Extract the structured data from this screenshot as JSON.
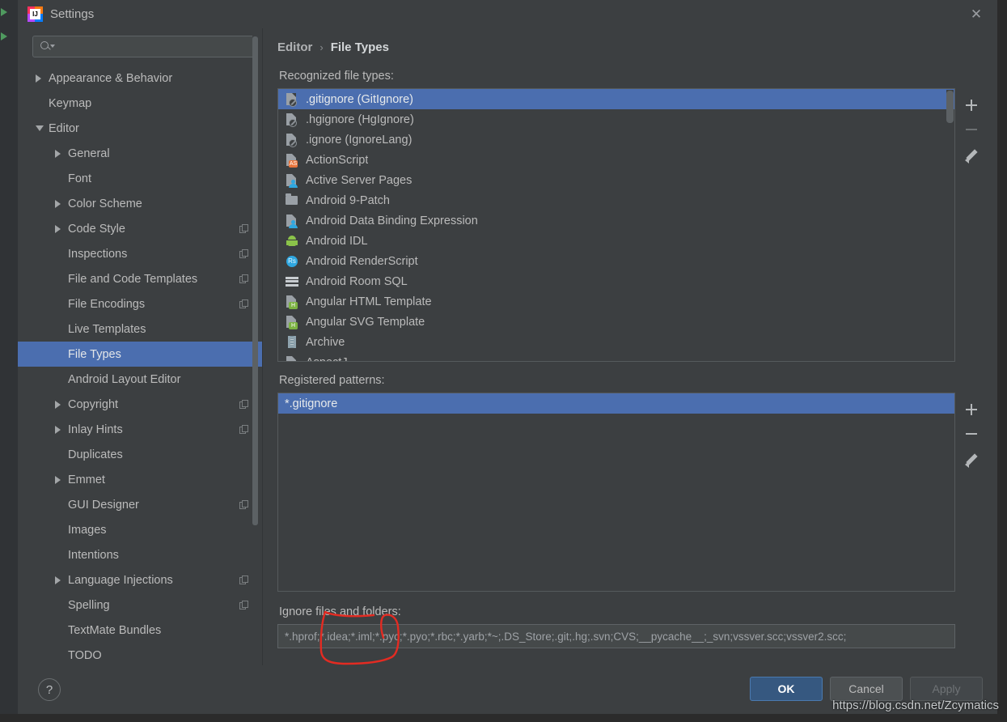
{
  "window": {
    "title": "Settings",
    "app_icon": "intellij-idea-icon",
    "close_icon": "close-icon"
  },
  "search": {
    "value": "",
    "placeholder": "",
    "icon": "search-icon"
  },
  "sidebar": {
    "items": [
      {
        "label": "Appearance & Behavior",
        "level": 1,
        "arrow": "right",
        "copy": false,
        "selected": false
      },
      {
        "label": "Keymap",
        "level": 1,
        "arrow": "none",
        "copy": false,
        "selected": false
      },
      {
        "label": "Editor",
        "level": 1,
        "arrow": "down",
        "copy": false,
        "selected": false
      },
      {
        "label": "General",
        "level": 2,
        "arrow": "right",
        "copy": false,
        "selected": false
      },
      {
        "label": "Font",
        "level": 2,
        "arrow": "none",
        "copy": false,
        "selected": false
      },
      {
        "label": "Color Scheme",
        "level": 2,
        "arrow": "right",
        "copy": false,
        "selected": false
      },
      {
        "label": "Code Style",
        "level": 2,
        "arrow": "right",
        "copy": true,
        "selected": false
      },
      {
        "label": "Inspections",
        "level": 2,
        "arrow": "none",
        "copy": true,
        "selected": false
      },
      {
        "label": "File and Code Templates",
        "level": 2,
        "arrow": "none",
        "copy": true,
        "selected": false
      },
      {
        "label": "File Encodings",
        "level": 2,
        "arrow": "none",
        "copy": true,
        "selected": false
      },
      {
        "label": "Live Templates",
        "level": 2,
        "arrow": "none",
        "copy": false,
        "selected": false
      },
      {
        "label": "File Types",
        "level": 2,
        "arrow": "none",
        "copy": false,
        "selected": true
      },
      {
        "label": "Android Layout Editor",
        "level": 2,
        "arrow": "none",
        "copy": false,
        "selected": false
      },
      {
        "label": "Copyright",
        "level": 2,
        "arrow": "right",
        "copy": true,
        "selected": false
      },
      {
        "label": "Inlay Hints",
        "level": 2,
        "arrow": "right",
        "copy": true,
        "selected": false
      },
      {
        "label": "Duplicates",
        "level": 2,
        "arrow": "none",
        "copy": false,
        "selected": false
      },
      {
        "label": "Emmet",
        "level": 2,
        "arrow": "right",
        "copy": false,
        "selected": false
      },
      {
        "label": "GUI Designer",
        "level": 2,
        "arrow": "none",
        "copy": true,
        "selected": false
      },
      {
        "label": "Images",
        "level": 2,
        "arrow": "none",
        "copy": false,
        "selected": false
      },
      {
        "label": "Intentions",
        "level": 2,
        "arrow": "none",
        "copy": false,
        "selected": false
      },
      {
        "label": "Language Injections",
        "level": 2,
        "arrow": "right",
        "copy": true,
        "selected": false
      },
      {
        "label": "Spelling",
        "level": 2,
        "arrow": "none",
        "copy": true,
        "selected": false
      },
      {
        "label": "TextMate Bundles",
        "level": 2,
        "arrow": "none",
        "copy": false,
        "selected": false
      },
      {
        "label": "TODO",
        "level": 2,
        "arrow": "none",
        "copy": false,
        "selected": false
      }
    ]
  },
  "breadcrumb": {
    "parent": "Editor",
    "separator": "›",
    "current": "File Types"
  },
  "recognized": {
    "label": "Recognized file types:",
    "items": [
      {
        "label": ".gitignore (GitIgnore)",
        "icon": "ignore-file-icon",
        "selected": true
      },
      {
        "label": ".hgignore (HgIgnore)",
        "icon": "ignore-file-icon",
        "selected": false
      },
      {
        "label": ".ignore (IgnoreLang)",
        "icon": "ignore-file-icon",
        "selected": false
      },
      {
        "label": "ActionScript",
        "icon": "actionscript-icon",
        "selected": false
      },
      {
        "label": "Active Server Pages",
        "icon": "asp-file-icon",
        "selected": false
      },
      {
        "label": "Android 9-Patch",
        "icon": "folder-icon",
        "selected": false
      },
      {
        "label": "Android Data Binding Expression",
        "icon": "asp-file-icon",
        "selected": false
      },
      {
        "label": "Android IDL",
        "icon": "android-icon",
        "selected": false
      },
      {
        "label": "Android RenderScript",
        "icon": "renderscript-icon",
        "selected": false
      },
      {
        "label": "Android Room SQL",
        "icon": "sql-rows-icon",
        "selected": false
      },
      {
        "label": "Angular HTML Template",
        "icon": "angular-html-icon",
        "selected": false
      },
      {
        "label": "Angular SVG Template",
        "icon": "angular-svg-icon",
        "selected": false
      },
      {
        "label": "Archive",
        "icon": "archive-icon",
        "selected": false
      },
      {
        "label": "AspectJ",
        "icon": "aspectj-icon",
        "selected": false
      }
    ],
    "toolbar": [
      {
        "name": "add-file-type-button",
        "icon": "plus-icon",
        "enabled": true
      },
      {
        "name": "remove-file-type-button",
        "icon": "minus-icon",
        "enabled": false
      },
      {
        "name": "edit-file-type-button",
        "icon": "pencil-icon",
        "enabled": true
      }
    ]
  },
  "patterns": {
    "label": "Registered patterns:",
    "items": [
      {
        "label": "*.gitignore",
        "selected": true
      }
    ],
    "toolbar": [
      {
        "name": "add-pattern-button",
        "icon": "plus-icon",
        "enabled": true
      },
      {
        "name": "remove-pattern-button",
        "icon": "minus-icon",
        "enabled": true
      },
      {
        "name": "edit-pattern-button",
        "icon": "pencil-icon",
        "enabled": true
      }
    ]
  },
  "ignore": {
    "label": "Ignore files and folders:",
    "value": "*.hprof;*.idea;*.iml;*.pyc;*.pyo;*.rbc;*.yarb;*~;.DS_Store;.git;.hg;.svn;CVS;__pycache__;_svn;vssver.scc;vssver2.scc;",
    "placeholder": ""
  },
  "footer": {
    "help_label": "?",
    "ok_label": "OK",
    "cancel_label": "Cancel",
    "apply_label": "Apply"
  },
  "overlay": {
    "watermark": "https://blog.csdn.net/Zcymatics",
    "annotation_color": "#e32b22"
  },
  "colors": {
    "dialog_bg": "#3c3f41",
    "selection_blue": "#4b6eaf",
    "ok_button": "#365880",
    "text": "#bbbbbb"
  }
}
